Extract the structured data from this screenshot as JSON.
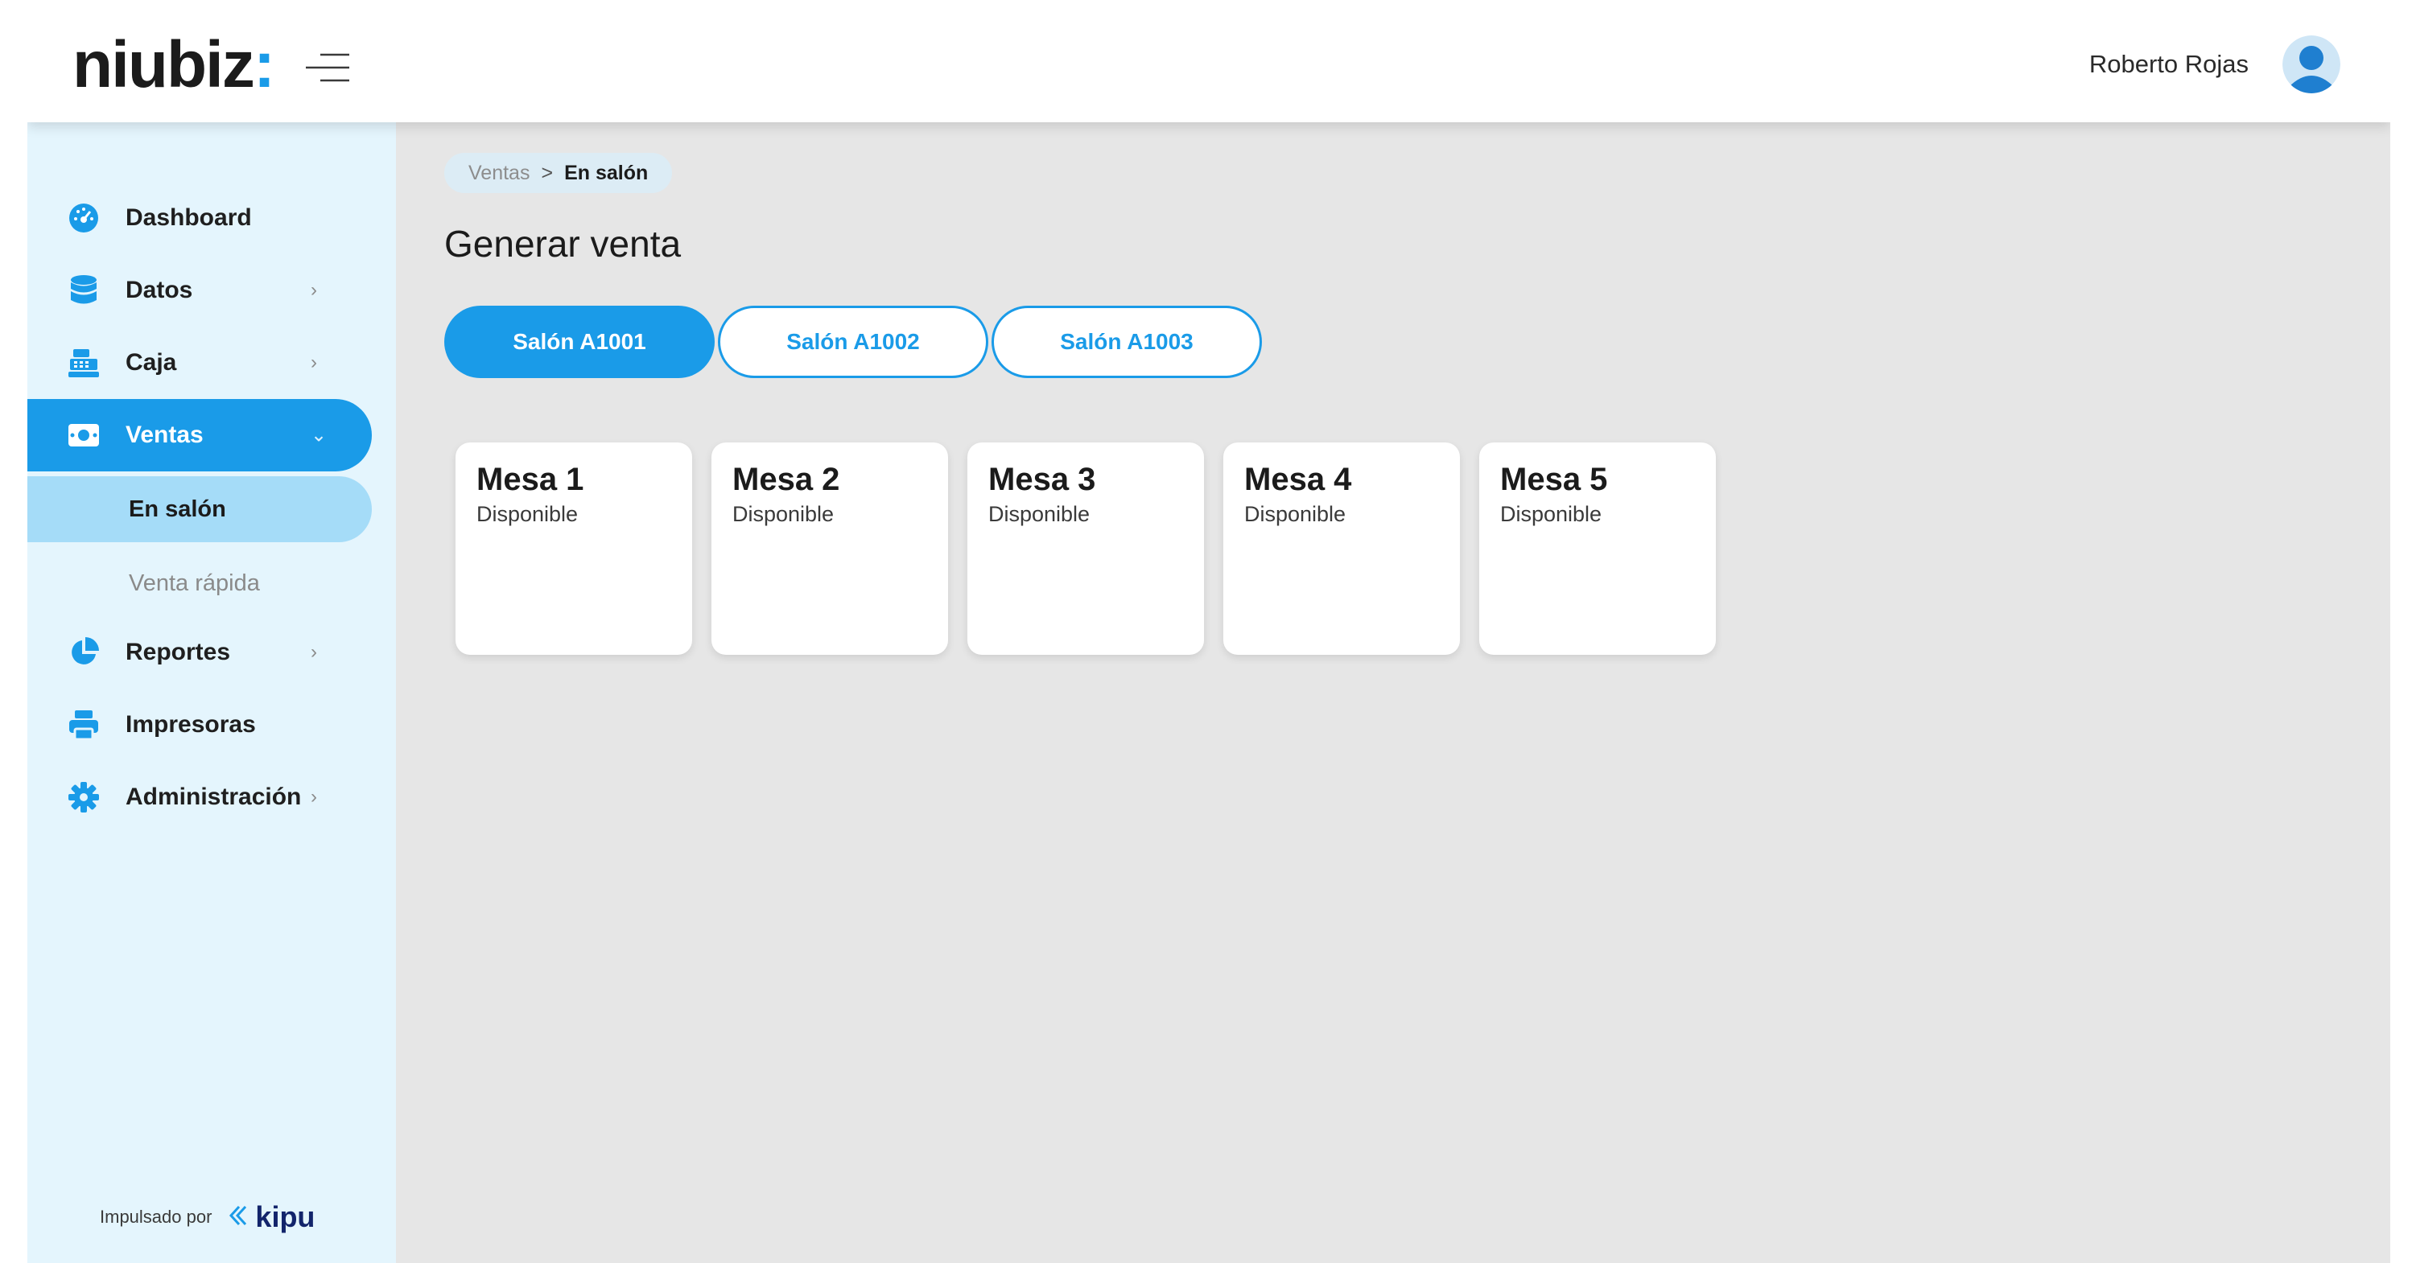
{
  "header": {
    "logo_text": "niubiz",
    "logo_colon": ":",
    "user_name": "Roberto Rojas"
  },
  "breadcrumb": {
    "parent": "Ventas",
    "separator": ">",
    "current": "En salón"
  },
  "page": {
    "title": "Generar venta"
  },
  "sidebar": {
    "items": [
      {
        "label": "Dashboard",
        "icon": "dashboard-gauge-icon"
      },
      {
        "label": "Datos",
        "icon": "database-icon",
        "chevron": "›"
      },
      {
        "label": "Caja",
        "icon": "cash-register-icon",
        "chevron": "›"
      },
      {
        "label": "Ventas",
        "icon": "money-bill-icon",
        "chevron": "⌄"
      },
      {
        "label": "Reportes",
        "icon": "pie-chart-icon",
        "chevron": "›"
      },
      {
        "label": "Impresoras",
        "icon": "printer-icon"
      },
      {
        "label": "Administración",
        "icon": "gear-icon",
        "chevron": "›"
      }
    ],
    "subitems": [
      {
        "label": "En salón"
      },
      {
        "label": "Venta rápida"
      }
    ],
    "powered_by": "Impulsado por",
    "brand": "kipu"
  },
  "tabs": [
    {
      "label": "Salón A1001"
    },
    {
      "label": "Salón A1002"
    },
    {
      "label": "Salón A1003"
    }
  ],
  "mesas": [
    {
      "title": "Mesa 1",
      "status": "Disponible"
    },
    {
      "title": "Mesa 2",
      "status": "Disponible"
    },
    {
      "title": "Mesa 3",
      "status": "Disponible"
    },
    {
      "title": "Mesa 4",
      "status": "Disponible"
    },
    {
      "title": "Mesa 5",
      "status": "Disponible"
    }
  ],
  "colors": {
    "accent": "#1a9be8",
    "sidebar_bg": "#e4f5fd",
    "selected_sub": "#a5dcf8",
    "content_bg": "#e6e6e6",
    "brand_dark": "#12246b"
  }
}
